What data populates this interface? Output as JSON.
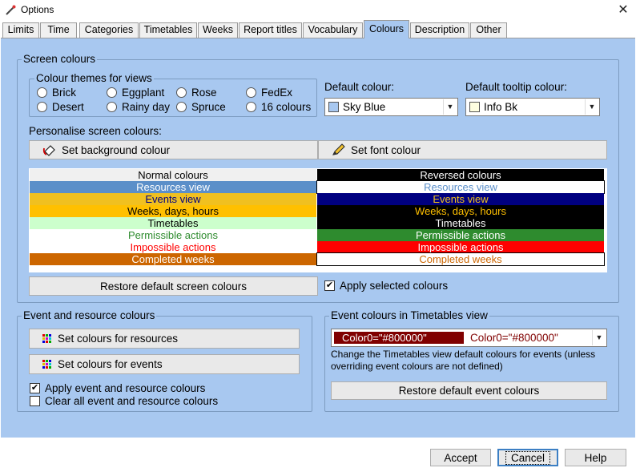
{
  "window": {
    "title": "Options",
    "close_glyph": "✕"
  },
  "tabs": [
    {
      "label": "Limits"
    },
    {
      "label": "Time"
    },
    {
      "label": "Categories"
    },
    {
      "label": "Timetables"
    },
    {
      "label": "Weeks"
    },
    {
      "label": "Report titles"
    },
    {
      "label": "Vocabulary"
    },
    {
      "label": "Colours",
      "active": true
    },
    {
      "label": "Description"
    },
    {
      "label": "Other"
    }
  ],
  "screen_colours": {
    "title": "Screen colours",
    "themes": {
      "title": "Colour themes for views",
      "options": [
        "Brick",
        "Eggplant",
        "Rose",
        "FedEx",
        "Desert",
        "Rainy day",
        "Spruce",
        "16 colours"
      ]
    },
    "default_colour": {
      "label": "Default colour:",
      "value": "Sky Blue",
      "swatch": "#a8c8f0"
    },
    "default_tooltip_colour": {
      "label": "Default tooltip colour:",
      "value": "Info Bk",
      "swatch": "#ffffe1"
    },
    "personalise_label": "Personalise screen colours:",
    "set_background_button": "Set background colour",
    "set_font_button": "Set font colour",
    "preview_rows": [
      {
        "left": "Normal colours",
        "left_bg": "#f0f0f0",
        "left_fg": "#000000",
        "right": "Reversed colours",
        "right_bg": "#000000",
        "right_fg": "#ffffff"
      },
      {
        "left": "Resources view",
        "left_bg": "#5b8fc9",
        "left_fg": "#ffffff",
        "right": "Resources view",
        "right_bg": "#ffffff",
        "right_fg": "#5b8fc9"
      },
      {
        "left": "Events view",
        "left_bg": "#f0c020",
        "left_fg": "#000080",
        "right": "Events view",
        "right_bg": "#000080",
        "right_fg": "#f0c020"
      },
      {
        "left": "Weeks, days, hours",
        "left_bg": "#ffc000",
        "left_fg": "#000000",
        "right": "Weeks, days, hours",
        "right_bg": "#000000",
        "right_fg": "#ffc000"
      },
      {
        "left": "Timetables",
        "left_bg": "#ccffcc",
        "left_fg": "#000000",
        "right": "Timetables",
        "right_bg": "#000000",
        "right_fg": "#ffffff"
      },
      {
        "left": "Permissible actions",
        "left_bg": "#ffffff",
        "left_fg": "#2e8b2e",
        "right": "Permissible actions",
        "right_bg": "#2e8b2e",
        "right_fg": "#ffffff"
      },
      {
        "left": "Impossible actions",
        "left_bg": "#ffffff",
        "left_fg": "#ff0000",
        "right": "Impossible actions",
        "right_bg": "#ff0000",
        "right_fg": "#ffffff"
      },
      {
        "left": "Completed weeks",
        "left_bg": "#cc6600",
        "left_fg": "#ffffff",
        "right": "Completed weeks",
        "right_bg": "#ffffff",
        "right_fg": "#cc6600"
      }
    ],
    "restore_button": "Restore default screen colours",
    "apply_selected": {
      "label": "Apply selected colours",
      "checked": true
    }
  },
  "event_resource_colours": {
    "title": "Event and resource colours",
    "set_resources_button": "Set colours for resources",
    "set_events_button": "Set colours for events",
    "apply_checkbox": {
      "label": "Apply event and resource colours",
      "checked": true
    },
    "clear_checkbox": {
      "label": "Clear all event and resource colours",
      "checked": false
    }
  },
  "timetables_event_colours": {
    "title": "Event colours in Timetables view",
    "combo_swatch_text": "Color0=\"#800000\"",
    "combo_value": "Color0=\"#800000\"",
    "swatch_colour": "#800000",
    "description": "Change the Timetables view default colours for events (unless overriding event colours are not defined)",
    "restore_button": "Restore default event colours"
  },
  "footer": {
    "accept": "Accept",
    "cancel": "Cancel",
    "help": "Help"
  }
}
